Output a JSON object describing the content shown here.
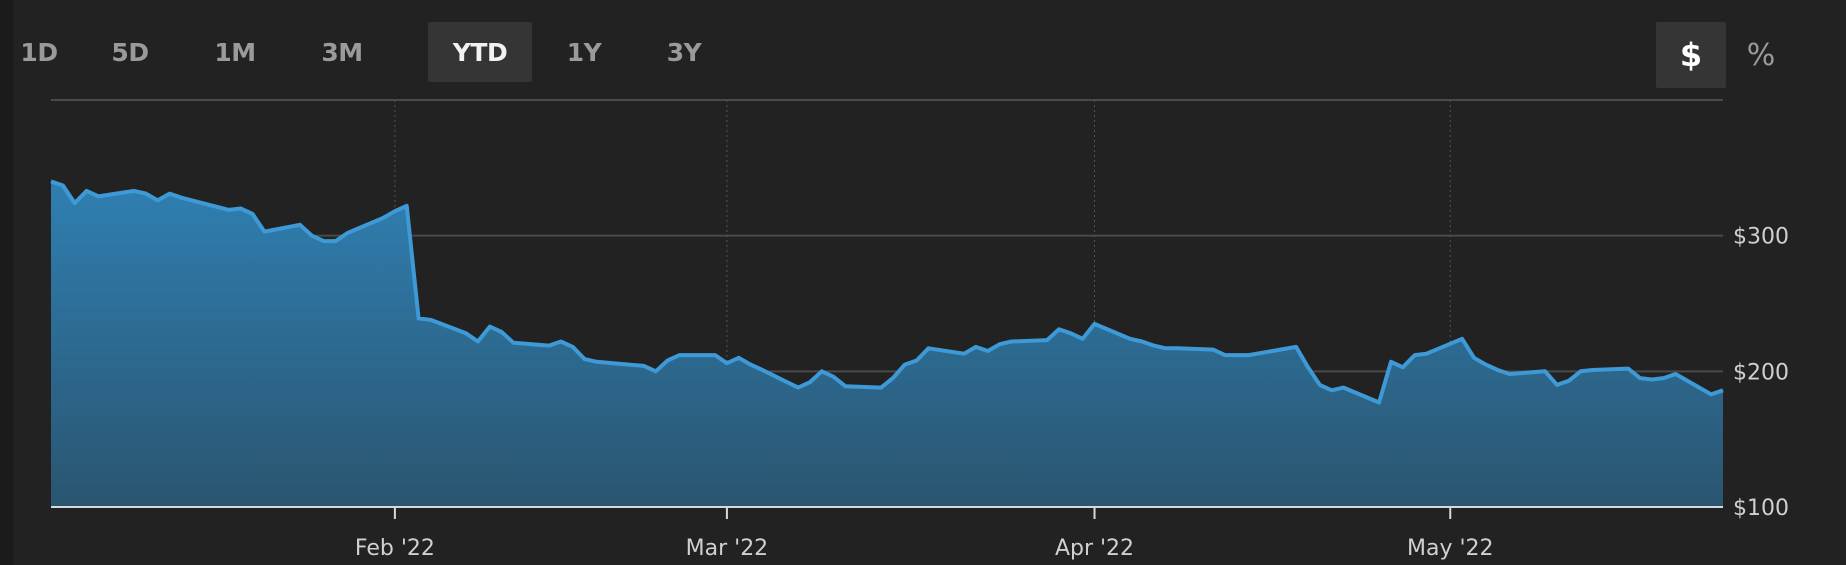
{
  "range_buttons": [
    {
      "label": "1D",
      "active": false
    },
    {
      "label": "5D",
      "active": false
    },
    {
      "label": "1M",
      "active": false
    },
    {
      "label": "3M",
      "active": false
    },
    {
      "label": "YTD",
      "active": true
    },
    {
      "label": "1Y",
      "active": false
    },
    {
      "label": "3Y",
      "active": false
    }
  ],
  "mode_buttons": [
    {
      "label": "$",
      "active": true
    },
    {
      "label": "%",
      "active": false
    }
  ],
  "colors": {
    "background": "#222222",
    "line": "#3d9ad6",
    "area_top": "#2f7fb2",
    "area_bottom": "#2a5570",
    "grid": "#4a4a4a",
    "axis": "#d8d8d8"
  },
  "chart_data": {
    "type": "area",
    "title": "",
    "xlabel": "",
    "ylabel": "",
    "ylim": [
      100,
      400
    ],
    "xlim": [
      "2022-01-03",
      "2022-05-24"
    ],
    "x_ticks": [
      {
        "date": "2022-02-01",
        "label": "Feb '22"
      },
      {
        "date": "2022-03-01",
        "label": "Mar '22"
      },
      {
        "date": "2022-04-01",
        "label": "Apr '22"
      },
      {
        "date": "2022-05-01",
        "label": "May '22"
      }
    ],
    "y_ticks": [
      {
        "value": 100,
        "label": "$100"
      },
      {
        "value": 200,
        "label": "$200"
      },
      {
        "value": 300,
        "label": "$300"
      }
    ],
    "grid": true,
    "series": [
      {
        "x": [
          "2022-01-03",
          "2022-01-04",
          "2022-01-05",
          "2022-01-06",
          "2022-01-07",
          "2022-01-10",
          "2022-01-11",
          "2022-01-12",
          "2022-01-13",
          "2022-01-14",
          "2022-01-18",
          "2022-01-19",
          "2022-01-20",
          "2022-01-21",
          "2022-01-24",
          "2022-01-25",
          "2022-01-26",
          "2022-01-27",
          "2022-01-28",
          "2022-01-31",
          "2022-02-01",
          "2022-02-02",
          "2022-02-03",
          "2022-02-04",
          "2022-02-07",
          "2022-02-08",
          "2022-02-09",
          "2022-02-10",
          "2022-02-11",
          "2022-02-14",
          "2022-02-15",
          "2022-02-16",
          "2022-02-17",
          "2022-02-18",
          "2022-02-22",
          "2022-02-23",
          "2022-02-24",
          "2022-02-25",
          "2022-02-28",
          "2022-03-01",
          "2022-03-02",
          "2022-03-03",
          "2022-03-04",
          "2022-03-07",
          "2022-03-08",
          "2022-03-09",
          "2022-03-10",
          "2022-03-11",
          "2022-03-14",
          "2022-03-15",
          "2022-03-16",
          "2022-03-17",
          "2022-03-18",
          "2022-03-21",
          "2022-03-22",
          "2022-03-23",
          "2022-03-24",
          "2022-03-25",
          "2022-03-28",
          "2022-03-29",
          "2022-03-30",
          "2022-03-31",
          "2022-04-01",
          "2022-04-04",
          "2022-04-05",
          "2022-04-06",
          "2022-04-07",
          "2022-04-08",
          "2022-04-11",
          "2022-04-12",
          "2022-04-13",
          "2022-04-14",
          "2022-04-18",
          "2022-04-19",
          "2022-04-20",
          "2022-04-21",
          "2022-04-22",
          "2022-04-25",
          "2022-04-26",
          "2022-04-27",
          "2022-04-28",
          "2022-04-29",
          "2022-05-02",
          "2022-05-03",
          "2022-05-04",
          "2022-05-05",
          "2022-05-06",
          "2022-05-09",
          "2022-05-10",
          "2022-05-11",
          "2022-05-12",
          "2022-05-13",
          "2022-05-16",
          "2022-05-17",
          "2022-05-18",
          "2022-05-19",
          "2022-05-20",
          "2022-05-23",
          "2022-05-24"
        ],
        "y": [
          340,
          337,
          324,
          333,
          329,
          333,
          331,
          326,
          331,
          328,
          319,
          320,
          316,
          303,
          308,
          300,
          296,
          296,
          302,
          313,
          318,
          322,
          239,
          238,
          228,
          222,
          233,
          229,
          221,
          219,
          222,
          218,
          209,
          207,
          204,
          200,
          208,
          212,
          212,
          206,
          210,
          205,
          201,
          188,
          192,
          200,
          196,
          189,
          188,
          195,
          205,
          208,
          217,
          213,
          218,
          215,
          220,
          222,
          223,
          231,
          228,
          224,
          235,
          224,
          222,
          219,
          217,
          217,
          216,
          212,
          212,
          212,
          218,
          203,
          190,
          186,
          188,
          177,
          207,
          203,
          212,
          213,
          224,
          210,
          205,
          201,
          198,
          200,
          190,
          193,
          200,
          201,
          202,
          195,
          194,
          195,
          198,
          183,
          186
        ]
      }
    ]
  }
}
